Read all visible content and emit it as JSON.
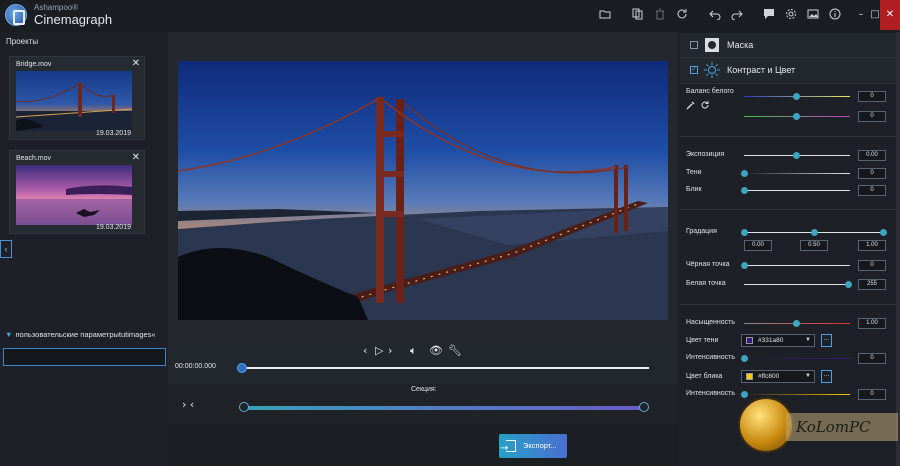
{
  "app": {
    "brand_small": "Ashampoo®",
    "brand_name": "Cinemagraph"
  },
  "toolbar": {
    "icons": [
      "folder-icon",
      "copy-icon",
      "trash-icon",
      "reset-icon",
      "undo-icon",
      "redo-icon",
      "chat-icon",
      "gear-icon",
      "image-icon",
      "info-icon"
    ],
    "window_controls": [
      "minimize-icon",
      "maximize-icon",
      "close-icon"
    ]
  },
  "projects": {
    "title": "Проекты",
    "items": [
      {
        "name": "Bridge.mov",
        "date": "19.03.2019"
      },
      {
        "name": "Beach.mov",
        "date": "19.03.2019"
      }
    ],
    "user_params_label": "пользовательские параметрыtutimages«",
    "user_params_value": ""
  },
  "player": {
    "timecode": "00:00:00.000",
    "progress": 0,
    "sections_label": "Секция:"
  },
  "export": {
    "label": "Экспорт..."
  },
  "right_panel": {
    "mask": {
      "label": "Маска",
      "checked": false
    },
    "contrast": {
      "label": "Контраст и Цвет",
      "checked": true
    },
    "white_balance": {
      "label": "Баланс белого",
      "value1": "0",
      "value2": "0"
    },
    "exposure": {
      "label": "Экспозиция",
      "value": "0.00"
    },
    "shadows": {
      "label": "Тени",
      "value": "0"
    },
    "highlights": {
      "label": "Блик",
      "value": "0"
    },
    "gradation": {
      "label": "Градация",
      "v1": "0.00",
      "v2": "0.50",
      "v3": "1.00"
    },
    "black_point": {
      "label": "Чёрная точка",
      "value": "0"
    },
    "white_point": {
      "label": "Белая точка",
      "value": "255"
    },
    "saturation": {
      "label": "Насыщенность",
      "value": "1.00"
    },
    "shadow_color": {
      "label": "Цвет тени",
      "hex": "#331a80",
      "swatch": "#331a80"
    },
    "intensity1": {
      "label": "Интенсивность",
      "value": "0"
    },
    "highlight_color": {
      "label": "Цвет блика",
      "hex": "#ffc800",
      "swatch": "#ffc800"
    },
    "intensity2": {
      "label": "Интенсивность",
      "value": "0"
    },
    "dots": "..."
  },
  "watermark": {
    "text": "KoLomPC"
  }
}
